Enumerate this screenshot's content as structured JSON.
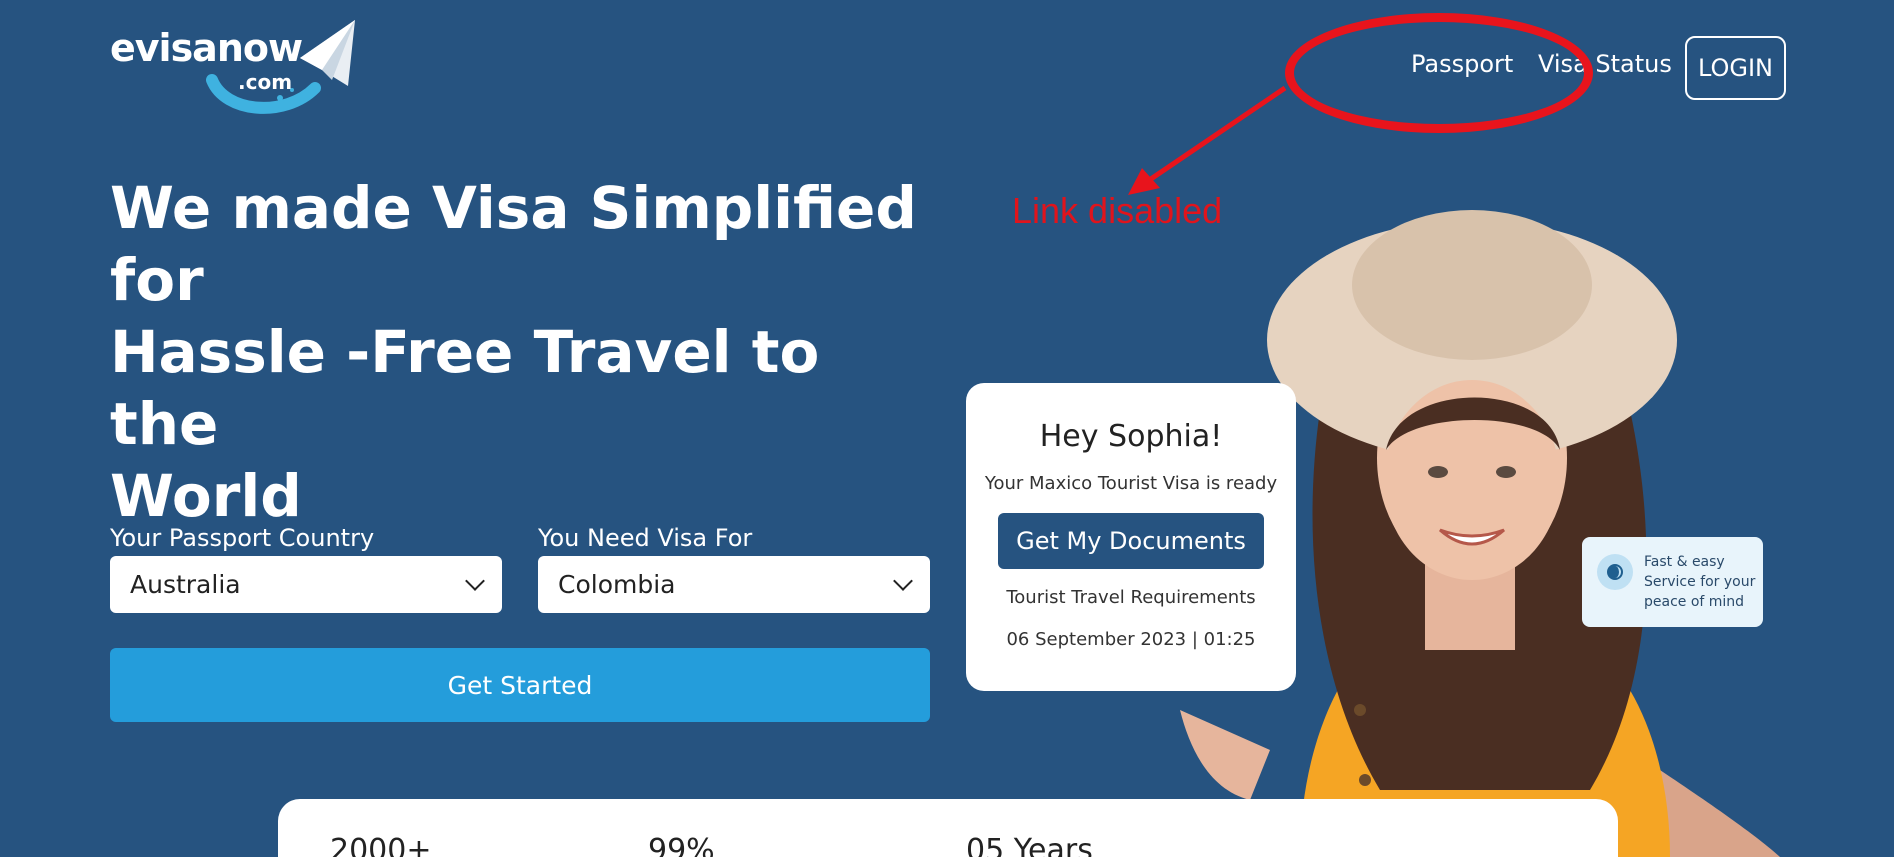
{
  "header": {
    "logo_main": "evisanow",
    "logo_sub": ".com",
    "nav": [
      {
        "label": "Passport"
      },
      {
        "label": "Visa Status"
      }
    ],
    "login_label": "LOGIN"
  },
  "annotation": {
    "text": "Link disabled",
    "color": "#e0141c"
  },
  "hero": {
    "headline_lines": [
      "We made Visa Simplified",
      "for",
      "Hassle -Free Travel to the",
      "World"
    ]
  },
  "form": {
    "passport_label": "Your Passport Country",
    "passport_value": "Australia",
    "visa_label": "You Need Visa For",
    "visa_value": "Colombia",
    "submit_label": "Get Started"
  },
  "notification_card": {
    "title": "Hey Sophia!",
    "subtitle": "Your Maxico Tourist Visa is ready",
    "button_label": "Get My Documents",
    "requirements": "Tourist Travel Requirements",
    "date": "06 September 2023 | 01:25"
  },
  "fast_card": {
    "lines": [
      "Fast & easy",
      "Service for your",
      "peace of mind"
    ]
  },
  "stats": [
    {
      "value": "2000+"
    },
    {
      "value": "99%"
    },
    {
      "value": "05 Years"
    }
  ],
  "colors": {
    "background": "#265380",
    "primary_button": "#249ddb",
    "dark_button": "#265380",
    "annotation": "#e8141c"
  }
}
